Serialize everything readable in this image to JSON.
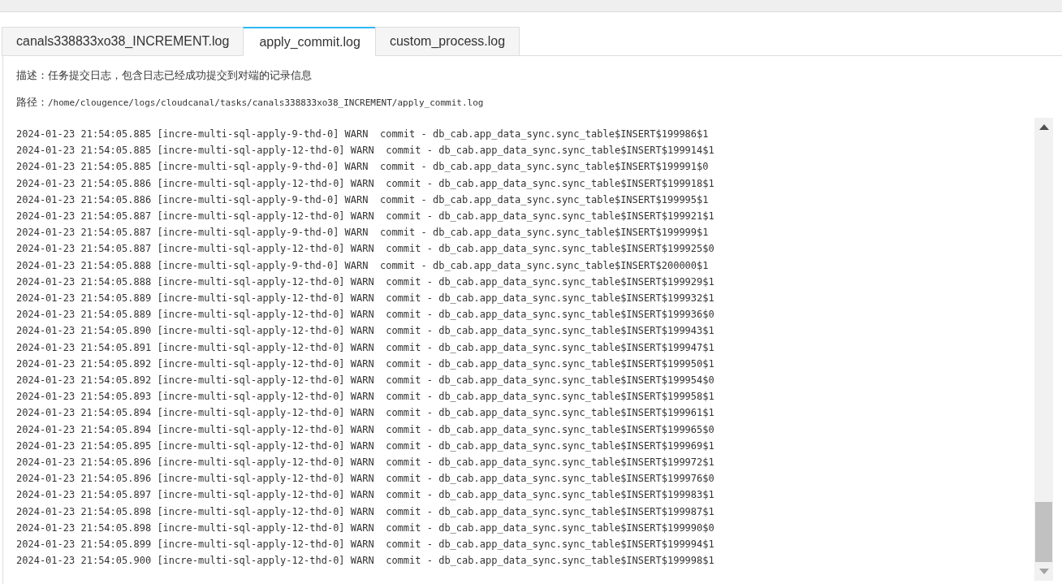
{
  "tabs": [
    {
      "label": "canals338833xo38_INCREMENT.log",
      "selected": false
    },
    {
      "label": "apply_commit.log",
      "selected": true
    },
    {
      "label": "custom_process.log",
      "selected": false
    }
  ],
  "description": {
    "label": "描述：",
    "text": "任务提交日志，包含日志已经成功提交到对端的记录信息"
  },
  "path": {
    "label": "路径：",
    "text": "/home/clougence/logs/cloudcanal/tasks/canals338833xo38_INCREMENT/apply_commit.log"
  },
  "log_lines": [
    "2024-01-23 21:54:05.885 [incre-multi-sql-apply-9-thd-0] WARN  commit - db_cab.app_data_sync.sync_table$INSERT$199986$1",
    "2024-01-23 21:54:05.885 [incre-multi-sql-apply-12-thd-0] WARN  commit - db_cab.app_data_sync.sync_table$INSERT$199914$1",
    "2024-01-23 21:54:05.885 [incre-multi-sql-apply-9-thd-0] WARN  commit - db_cab.app_data_sync.sync_table$INSERT$199991$0",
    "2024-01-23 21:54:05.886 [incre-multi-sql-apply-12-thd-0] WARN  commit - db_cab.app_data_sync.sync_table$INSERT$199918$1",
    "2024-01-23 21:54:05.886 [incre-multi-sql-apply-9-thd-0] WARN  commit - db_cab.app_data_sync.sync_table$INSERT$199995$1",
    "2024-01-23 21:54:05.887 [incre-multi-sql-apply-12-thd-0] WARN  commit - db_cab.app_data_sync.sync_table$INSERT$199921$1",
    "2024-01-23 21:54:05.887 [incre-multi-sql-apply-9-thd-0] WARN  commit - db_cab.app_data_sync.sync_table$INSERT$199999$1",
    "2024-01-23 21:54:05.887 [incre-multi-sql-apply-12-thd-0] WARN  commit - db_cab.app_data_sync.sync_table$INSERT$199925$0",
    "2024-01-23 21:54:05.888 [incre-multi-sql-apply-9-thd-0] WARN  commit - db_cab.app_data_sync.sync_table$INSERT$200000$1",
    "2024-01-23 21:54:05.888 [incre-multi-sql-apply-12-thd-0] WARN  commit - db_cab.app_data_sync.sync_table$INSERT$199929$1",
    "2024-01-23 21:54:05.889 [incre-multi-sql-apply-12-thd-0] WARN  commit - db_cab.app_data_sync.sync_table$INSERT$199932$1",
    "2024-01-23 21:54:05.889 [incre-multi-sql-apply-12-thd-0] WARN  commit - db_cab.app_data_sync.sync_table$INSERT$199936$0",
    "2024-01-23 21:54:05.890 [incre-multi-sql-apply-12-thd-0] WARN  commit - db_cab.app_data_sync.sync_table$INSERT$199943$1",
    "2024-01-23 21:54:05.891 [incre-multi-sql-apply-12-thd-0] WARN  commit - db_cab.app_data_sync.sync_table$INSERT$199947$1",
    "2024-01-23 21:54:05.892 [incre-multi-sql-apply-12-thd-0] WARN  commit - db_cab.app_data_sync.sync_table$INSERT$199950$1",
    "2024-01-23 21:54:05.892 [incre-multi-sql-apply-12-thd-0] WARN  commit - db_cab.app_data_sync.sync_table$INSERT$199954$0",
    "2024-01-23 21:54:05.893 [incre-multi-sql-apply-12-thd-0] WARN  commit - db_cab.app_data_sync.sync_table$INSERT$199958$1",
    "2024-01-23 21:54:05.894 [incre-multi-sql-apply-12-thd-0] WARN  commit - db_cab.app_data_sync.sync_table$INSERT$199961$1",
    "2024-01-23 21:54:05.894 [incre-multi-sql-apply-12-thd-0] WARN  commit - db_cab.app_data_sync.sync_table$INSERT$199965$0",
    "2024-01-23 21:54:05.895 [incre-multi-sql-apply-12-thd-0] WARN  commit - db_cab.app_data_sync.sync_table$INSERT$199969$1",
    "2024-01-23 21:54:05.896 [incre-multi-sql-apply-12-thd-0] WARN  commit - db_cab.app_data_sync.sync_table$INSERT$199972$1",
    "2024-01-23 21:54:05.896 [incre-multi-sql-apply-12-thd-0] WARN  commit - db_cab.app_data_sync.sync_table$INSERT$199976$0",
    "2024-01-23 21:54:05.897 [incre-multi-sql-apply-12-thd-0] WARN  commit - db_cab.app_data_sync.sync_table$INSERT$199983$1",
    "2024-01-23 21:54:05.898 [incre-multi-sql-apply-12-thd-0] WARN  commit - db_cab.app_data_sync.sync_table$INSERT$199987$1",
    "2024-01-23 21:54:05.898 [incre-multi-sql-apply-12-thd-0] WARN  commit - db_cab.app_data_sync.sync_table$INSERT$199990$0",
    "2024-01-23 21:54:05.899 [incre-multi-sql-apply-12-thd-0] WARN  commit - db_cab.app_data_sync.sync_table$INSERT$199994$1",
    "2024-01-23 21:54:05.900 [incre-multi-sql-apply-12-thd-0] WARN  commit - db_cab.app_data_sync.sync_table$INSERT$199998$1"
  ]
}
